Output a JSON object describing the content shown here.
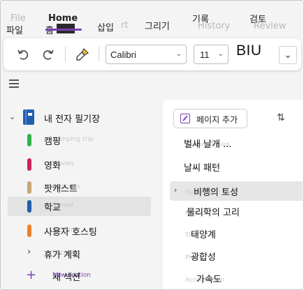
{
  "ribbon": {
    "tabs": [
      {
        "label": "파일",
        "ghost": "File"
      },
      {
        "label": "홈",
        "ghost": "Home"
      },
      {
        "label": "삽입",
        "ghost": "rt"
      },
      {
        "label": "그리기",
        "ghost": ""
      },
      {
        "label": "기록",
        "ghost": "History"
      },
      {
        "label": "검토",
        "ghost": "Review"
      }
    ]
  },
  "toolbar": {
    "undo_icon": "undo-icon",
    "redo_icon": "redo-icon",
    "format_painter_icon": "paintbrush-icon",
    "font_name": "Calibri",
    "font_size": "11",
    "format_label": "BIU",
    "more_icon": "chevron-down-icon"
  },
  "nav": {
    "notebook": "내 전자 필기장",
    "sections": [
      {
        "label": "캠핑",
        "ghost": "Camping trip",
        "color": "#2db34a"
      },
      {
        "label": "영화",
        "ghost": "Movies",
        "color": "#c9245c"
      },
      {
        "label": "팟캐스트",
        "ghost": "Podcasts",
        "color": "#c8a57a"
      },
      {
        "label": "학교",
        "ghost": "School",
        "color": "#1f5fae"
      },
      {
        "label": "사용자 호스팅",
        "ghost": "Hosting",
        "color": "#f07f2a"
      }
    ],
    "group": {
      "label": "휴가 계획",
      "ghost": "Vacation"
    },
    "new_section": {
      "label": "새 섹션",
      "ghost": "New section"
    }
  },
  "pages": {
    "add_label": "페이지 추가",
    "sort_icon": "sort-icon",
    "items": [
      {
        "label": "벌새 날개 ...",
        "ghost": "Hummingbird"
      },
      {
        "label": "날씨 패턴",
        "ghost": ""
      },
      {
        "label": "비행의 토성",
        "ghost": "Flight"
      },
      {
        "label": "물리학의 고리",
        "ghost": "Physics"
      },
      {
        "label": "태양계",
        "ghost": "The"
      },
      {
        "label": "광합성",
        "ghost": "Photo"
      },
      {
        "label": "가속도",
        "ghost": "Acceleration"
      }
    ]
  }
}
